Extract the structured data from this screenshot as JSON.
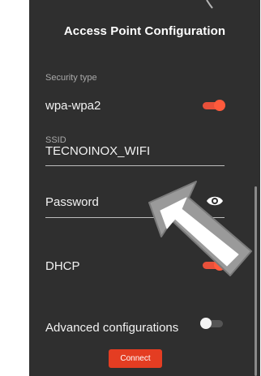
{
  "dialog": {
    "title": "Access Point Configuration"
  },
  "security": {
    "label": "Security type",
    "value": "wpa-wpa2",
    "toggle_on": true
  },
  "ssid": {
    "label": "SSID",
    "value": "TECNOINOX_WIFI"
  },
  "password": {
    "placeholder": "Password",
    "value": "",
    "visibility_icon": "eye-icon"
  },
  "dhcp": {
    "label": "DHCP",
    "toggle_on": true
  },
  "advanced": {
    "label": "Advanced configurations",
    "toggle_on": false
  },
  "connect": {
    "label": "Connect"
  },
  "colors": {
    "panel_bg": "#2f2f2f",
    "accent": "#e43d22",
    "toggle_on": "#ff5a3c",
    "text": "#f2f2f2",
    "muted_text": "#a9a9a9"
  }
}
